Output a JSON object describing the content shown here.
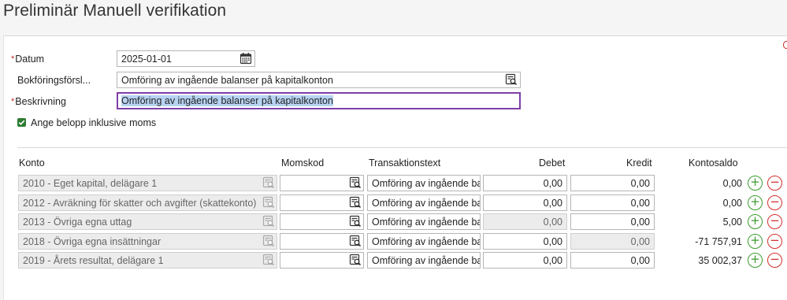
{
  "page": {
    "title": "Preliminär Manuell verifikation"
  },
  "form": {
    "date_label": "Datum",
    "date_value": "2025-01-01",
    "proposal_label": "Bokföringsförsl...",
    "proposal_value": "Omföring av ingående balanser på kapitalkonton",
    "description_label": "Beskrivning",
    "description_value": "Omföring av ingående balanser på kapitalkonton",
    "incl_vat_label": "Ange belopp inklusive moms",
    "incl_vat_checked": true,
    "required_marker": "*"
  },
  "table": {
    "headers": {
      "konto": "Konto",
      "momskod": "Momskod",
      "transaktionstext": "Transaktionstext",
      "debet": "Debet",
      "kredit": "Kredit",
      "kontosaldo": "Kontosaldo"
    },
    "rows": [
      {
        "konto": "2010 - Eget kapital, delägare 1",
        "momskod": "",
        "text": "Omföring av ingående ba",
        "debet": "0,00",
        "kredit": "0,00",
        "saldo": "0,00",
        "debet_disabled": false,
        "kredit_disabled": false
      },
      {
        "konto": "2012 - Avräkning för skatter och avgifter (skattekonto)",
        "momskod": "",
        "text": "Omföring av ingående ba",
        "debet": "0,00",
        "kredit": "0,00",
        "saldo": "0,00",
        "debet_disabled": false,
        "kredit_disabled": false
      },
      {
        "konto": "2013 - Övriga egna uttag",
        "momskod": "",
        "text": "Omföring av ingående ba",
        "debet": "0,00",
        "kredit": "0,00",
        "saldo": "5,00",
        "debet_disabled": true,
        "kredit_disabled": false
      },
      {
        "konto": "2018 - Övriga egna insättningar",
        "momskod": "",
        "text": "Omföring av ingående ba",
        "debet": "0,00",
        "kredit": "0,00",
        "saldo": "-71 757,91",
        "debet_disabled": false,
        "kredit_disabled": true
      },
      {
        "konto": "2019 - Årets resultat, delägare 1",
        "momskod": "",
        "text": "Omföring av ingående ba",
        "debet": "0,00",
        "kredit": "0,00",
        "saldo": "35 002,37",
        "debet_disabled": false,
        "kredit_disabled": false
      }
    ],
    "add_symbol": "+",
    "remove_symbol": "−"
  },
  "colors": {
    "accent_focus": "#7e3fa8",
    "add_green": "#3a9a2c",
    "remove_red": "#d32f2f",
    "required_red": "#c62828",
    "check_green": "#2e7d32"
  },
  "icons": {
    "date_picker": "calendar-icon",
    "lookup": "search-list-icon",
    "checkbox": "check-icon"
  }
}
